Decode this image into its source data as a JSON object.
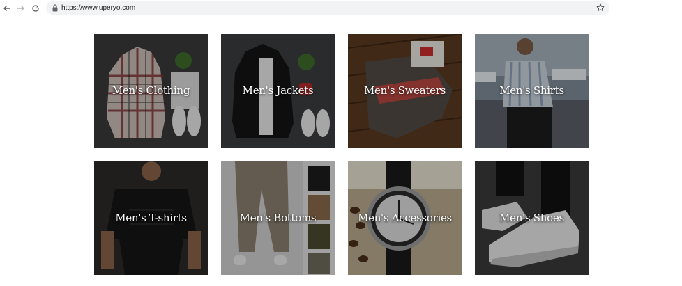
{
  "browser": {
    "url": "https://www.uperyo.com",
    "icons": {
      "back": "back-arrow-icon",
      "forward": "forward-arrow-icon",
      "reload": "reload-icon",
      "lock": "lock-icon",
      "bookmark": "star-icon"
    }
  },
  "categories": [
    {
      "label": "Men's Clothing"
    },
    {
      "label": "Men's Jackets"
    },
    {
      "label": "Men's Sweaters"
    },
    {
      "label": "Men's Shirts"
    },
    {
      "label": "Men's T-shirts"
    },
    {
      "label": "Men's Bottoms"
    },
    {
      "label": "Men's Accessories"
    },
    {
      "label": "Men's Shoes"
    }
  ]
}
